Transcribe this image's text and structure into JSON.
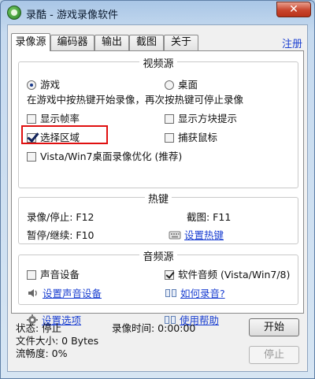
{
  "window": {
    "title": "录酷 - 游戏录像软件",
    "close_glyph": "✕"
  },
  "tabs": [
    {
      "label": "录像源",
      "active": true
    },
    {
      "label": "编码器"
    },
    {
      "label": "输出"
    },
    {
      "label": "截图"
    },
    {
      "label": "关于"
    }
  ],
  "register_link": "注册",
  "video_source": {
    "legend": "视频源",
    "radio_game": "游戏",
    "radio_desktop": "桌面",
    "hint": "在游戏中按热键开始录像，再次按热键可停止录像",
    "show_fps": "显示帧率",
    "show_block_hint": "显示方块提示",
    "select_region": "选择区域",
    "capture_mouse": "捕获鼠标",
    "vista_opt": "Vista/Win7桌面录像优化 (推荐)"
  },
  "hotkeys": {
    "legend": "热键",
    "record_label": "录像/停止: F12",
    "screenshot_label": "截图: F11",
    "pause_label": "暂停/继续: F10",
    "set_hotkey": "设置热键"
  },
  "audio_source": {
    "legend": "音频源",
    "sound_device": "声音设备",
    "software_audio": "软件音频 (Vista/Win7/8)",
    "set_sound_device": "设置声音设备",
    "how_to_record": "如何录音?"
  },
  "footer_links": {
    "options": "设置选项",
    "help": "使用帮助"
  },
  "status": {
    "state": "状态: 停止",
    "record_time": "录像时间: 0:00:00",
    "file_size": "文件大小: 0 Bytes",
    "smoothness": "流畅度: 0%",
    "progress": 0
  },
  "buttons": {
    "start": "开始",
    "stop": "停止"
  }
}
